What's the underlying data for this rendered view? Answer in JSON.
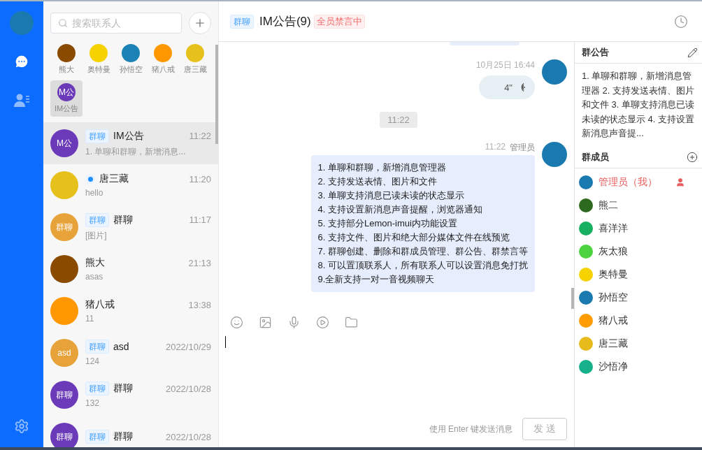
{
  "nav": {
    "items": [
      {
        "kind": "chat",
        "selected": true
      },
      {
        "kind": "contacts",
        "selected": false
      }
    ]
  },
  "search": {
    "placeholder": "搜索联系人"
  },
  "quick_contacts": [
    {
      "name": "熊大",
      "color": "#8a4a00",
      "selected": false
    },
    {
      "name": "奥特曼",
      "color": "#f5d200",
      "selected": false
    },
    {
      "name": "孙悟空",
      "color": "#1a82b5",
      "selected": false
    },
    {
      "name": "猪八戒",
      "color": "#ff9800",
      "selected": false
    },
    {
      "name": "唐三藏",
      "color": "#e6c01b",
      "selected": false
    },
    {
      "name": "IM公告",
      "color": "#6a3ab8",
      "avatar_text": "M公",
      "selected": true
    }
  ],
  "conversations": [
    {
      "name": "IM公告",
      "time": "11:22",
      "preview": "1. 单聊和群聊，新增消息...",
      "tag": "群聊",
      "dot": false,
      "color": "#6a3ab8",
      "avatar_text": "M公",
      "selected": true
    },
    {
      "name": "唐三藏",
      "time": "11:20",
      "preview": "hello",
      "dot": true,
      "color": "#e6c01b",
      "selected": false
    },
    {
      "name": "群聊",
      "time": "11:17",
      "preview": "[图片]",
      "tag": "群聊",
      "dot": false,
      "color": "#e8a23a",
      "avatar_text": "群聊",
      "selected": false
    },
    {
      "name": "熊大",
      "time": "21:13",
      "preview": "asas",
      "dot": false,
      "color": "#8a4a00",
      "selected": false
    },
    {
      "name": "猪八戒",
      "time": "13:38",
      "preview": "11",
      "dot": false,
      "color": "#ff9800",
      "selected": false
    },
    {
      "name": "asd",
      "time": "2022/10/29",
      "preview": "124",
      "tag": "群聊",
      "dot": false,
      "color": "#e8a23a",
      "avatar_text": "asd",
      "selected": false
    },
    {
      "name": "群聊",
      "time": "2022/10/28",
      "preview": "132",
      "tag": "群聊",
      "dot": false,
      "color": "#6a3ab8",
      "avatar_text": "群聊",
      "selected": false
    },
    {
      "name": "群聊",
      "time": "2022/10/28",
      "tag": "群聊",
      "dot": false,
      "color": "#6a3ab8",
      "avatar_text": "群聊",
      "selected": false
    }
  ],
  "chat": {
    "tag": "群聊",
    "title": "IM公告(9)",
    "mute_badge": "全员禁言中",
    "messages": [
      {
        "kind": "voice",
        "time": "10月25日 16:44",
        "duration": "4\"",
        "color": "#1a7ab0"
      },
      {
        "kind": "divider",
        "time": "11:22"
      },
      {
        "kind": "text",
        "time": "11:22",
        "sender": "管理员",
        "color": "#1a7ab0",
        "lines": [
          "1. 单聊和群聊，新增消息管理器",
          "2. 支持发送表情、图片和文件",
          "3. 单聊支持消息已读未读的状态显示",
          "4. 支持设置新消息声音提醒，浏览器通知",
          "5. 支持部分Lemon-imui内功能设置",
          "6. 支持文件、图片和绝大部分媒体文件在线预览",
          "7. 群聊创建、删除和群成员管理、群公告、群禁言等",
          "8. 可以置顶联系人，所有联系人可以设置消息免打扰",
          "9.全新支持一对一音视频聊天"
        ]
      }
    ],
    "hint": "使用 Enter 键发送消息",
    "send": "发 送"
  },
  "panel": {
    "notice_title": "群公告",
    "notice": "1. 单聊和群聊，新增消息管理器 2. 支持发送表情、图片和文件 3. 单聊支持消息已读未读的状态显示 4. 支持设置新消息声音提...",
    "members_title": "群成员",
    "members": [
      {
        "name": "管理员（我）",
        "self": true,
        "color": "#1a7ab0"
      },
      {
        "name": "熊二",
        "self": false,
        "color": "#2d6a1f"
      },
      {
        "name": "喜洋洋",
        "self": false,
        "color": "#16b060"
      },
      {
        "name": "灰太狼",
        "self": false,
        "color": "#4cd23f"
      },
      {
        "name": "奥特曼",
        "self": false,
        "color": "#f5d200"
      },
      {
        "name": "孙悟空",
        "self": false,
        "color": "#1a7ab0"
      },
      {
        "name": "猪八戒",
        "self": false,
        "color": "#ff9c00"
      },
      {
        "name": "唐三藏",
        "self": false,
        "color": "#e6bb1b"
      },
      {
        "name": "沙悟净",
        "self": false,
        "color": "#16b08a"
      }
    ]
  }
}
